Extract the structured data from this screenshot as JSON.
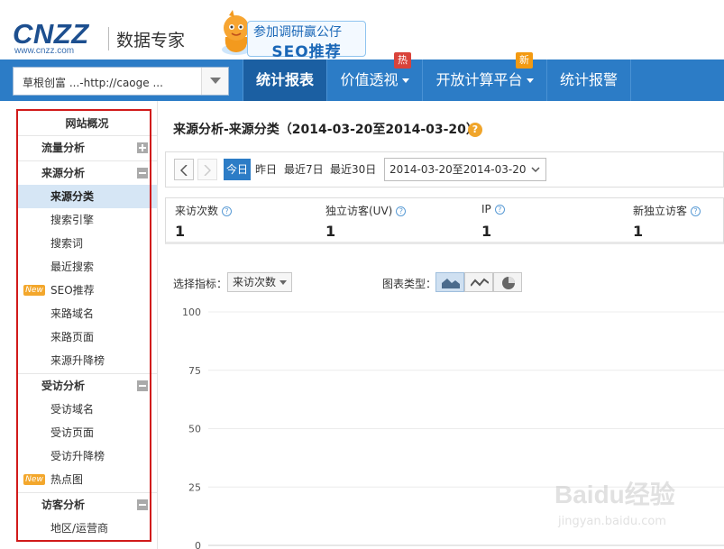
{
  "header": {
    "logo_text": "CNZZ",
    "logo_sub": "www.cnzz.com",
    "product_title": "数据专家",
    "banner_line1": "参加调研赢公仔",
    "banner_line2": "SEO推荐"
  },
  "navbar": {
    "site_select_value": "草根创富 ...-http://caoge ...",
    "items": [
      {
        "label": "统计报表",
        "active": true
      },
      {
        "label": "价值透视",
        "badge": "热"
      },
      {
        "label": "开放计算平台",
        "badge": "新"
      },
      {
        "label": "统计报警"
      }
    ]
  },
  "sidebar": {
    "overview": "网站概况",
    "groups": [
      {
        "label": "流量分析",
        "toggle": "plus"
      },
      {
        "label": "来源分析",
        "toggle": "minus"
      },
      {
        "label": "受访分析",
        "toggle": "minus"
      },
      {
        "label": "访客分析",
        "toggle": "minus"
      }
    ],
    "source_items": [
      "来源分类",
      "搜索引擎",
      "搜索词",
      "最近搜索",
      "SEO推荐",
      "来路域名",
      "来路页面",
      "来源升降榜"
    ],
    "visit_items": [
      "受访域名",
      "受访页面",
      "受访升降榜",
      "热点图"
    ],
    "visitor_items": [
      "地区/运营商"
    ],
    "new_tag": "New"
  },
  "main": {
    "title": "来源分析-来源分类（2014-03-20至2014-03-20）",
    "help": "?",
    "date_links": [
      "今日",
      "昨日",
      "最近7日",
      "最近30日"
    ],
    "date_range": "2014-03-20至2014-03-20",
    "stats": [
      {
        "label": "来访次数",
        "value": "1"
      },
      {
        "label": "独立访客(UV)",
        "value": "1"
      },
      {
        "label": "IP",
        "value": "1"
      },
      {
        "label": "新独立访客",
        "value": "1"
      }
    ],
    "metric_label": "选择指标：",
    "metric_value": "来访次数",
    "chart_type_label": "图表类型："
  },
  "chart_data": {
    "type": "area",
    "y_ticks": [
      "100",
      "75",
      "50",
      "25",
      "0"
    ],
    "ylim": [
      0,
      100
    ],
    "grid": true,
    "xlabel": "",
    "ylabel": ""
  },
  "watermark": {
    "text": "Baidu经验",
    "sub": "jingyan.baidu.com"
  },
  "colors": {
    "nav_bg": "#2c7cc6",
    "nav_active": "#1b5fa2",
    "sidebar_active": "#d6e6f5",
    "highlight_border": "#d11a1a",
    "badge_hot": "#d9433b",
    "badge_new": "#f39a12"
  }
}
